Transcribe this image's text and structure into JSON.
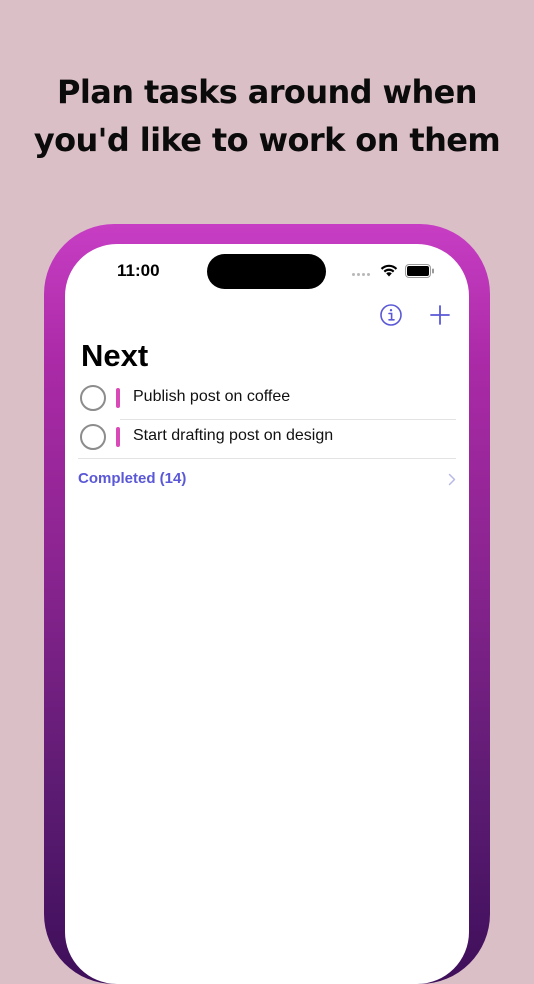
{
  "headline": {
    "line1": "Plan tasks around when",
    "line2": "you'd like to work on them"
  },
  "status_bar": {
    "time": "11:00"
  },
  "toolbar": {
    "info_icon": "info-circle-icon",
    "add_icon": "plus-icon"
  },
  "page": {
    "title": "Next"
  },
  "tasks": [
    {
      "label": "Publish post on coffee",
      "color": "#d94ab8"
    },
    {
      "label": "Start drafting post on design",
      "color": "#d94ab8"
    }
  ],
  "completed": {
    "label": "Completed (14)"
  },
  "colors": {
    "background": "#dbbfc6",
    "accent": "#5a58d6",
    "frame_top": "#c73ec4",
    "frame_bottom": "#3e0f5a"
  }
}
